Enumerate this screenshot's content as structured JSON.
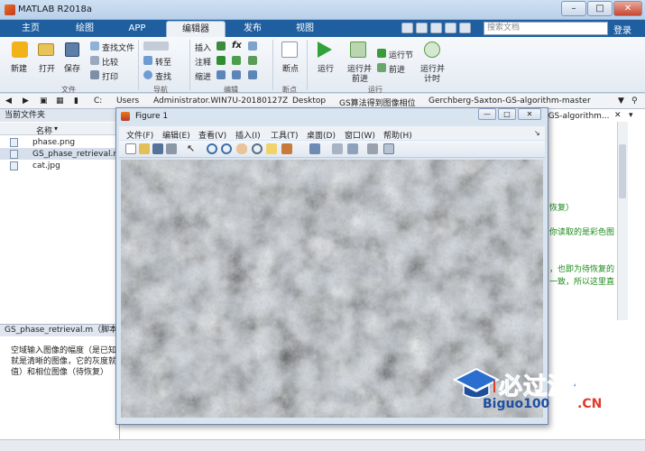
{
  "window": {
    "title": "MATLAB R2018a",
    "controls": [
      "–",
      "□",
      "✕"
    ]
  },
  "tabs": [
    "主页",
    "绘图",
    "APP",
    "编辑器",
    "发布",
    "视图"
  ],
  "active_tab": "编辑器",
  "search": {
    "placeholder": "搜索文档"
  },
  "login_label": "登录",
  "ribbon": {
    "file": {
      "new": "新建",
      "open": "打开",
      "save": "保存",
      "find_files": "查找文件",
      "compare": "比较",
      "print": "打印",
      "group": "文件"
    },
    "navigate": {
      "goto": "转至",
      "find": "查找",
      "group": "导航"
    },
    "edit": {
      "insert": "插入",
      "comment": "注释",
      "indent": "缩进",
      "fx": "fx",
      "group": "编辑"
    },
    "breakpoints": {
      "label": "断点",
      "group": "断点"
    },
    "run": {
      "run": "运行",
      "run_advance_1": "运行并",
      "run_advance_2": "前进",
      "run_section": "运行节",
      "advance": "前进",
      "run_time_1": "运行并",
      "run_time_2": "计时",
      "group": "运行"
    }
  },
  "address": {
    "segments": [
      "C:",
      "Users",
      "Administrator.WIN7U-20180127Z",
      "Desktop",
      "GS算法得到图像相位",
      "Gerchberg-Saxton-GS-algorithm-master"
    ]
  },
  "current_folder": {
    "title": "当前文件夹",
    "column": "名称",
    "files": [
      "phase.png",
      "GS_phase_retrieval.m",
      "cat.jpg"
    ]
  },
  "details": {
    "bar": "GS_phase_retrieval.m（脚本）",
    "lines": [
      "空域输入图像的幅度（是已知",
      "就是清晰的图像，它的灰度就",
      "值）和相位图像（待恢复）"
    ]
  },
  "editor": {
    "tab_label": "-GS-algorithm...",
    "fragments": [
      "恢复）",
      "你读取的是彩色图",
      "，也即为待恢复的",
      "一致，所以这里直"
    ]
  },
  "figure": {
    "title": "Figure 1",
    "buttons": [
      "—",
      "□",
      "✕"
    ],
    "menu": [
      "文件(F)",
      "编辑(E)",
      "查看(V)",
      "插入(I)",
      "工具(T)",
      "桌面(D)",
      "窗口(W)",
      "帮助(H)"
    ]
  },
  "watermark": {
    "title": "必过源码",
    "sub1": "Biguo100",
    "sub2": ".CN"
  },
  "colors": {
    "tab_strip": "#1f5fa0",
    "accent": "#2a7bd4",
    "comment_green": "#1b8a1b"
  }
}
